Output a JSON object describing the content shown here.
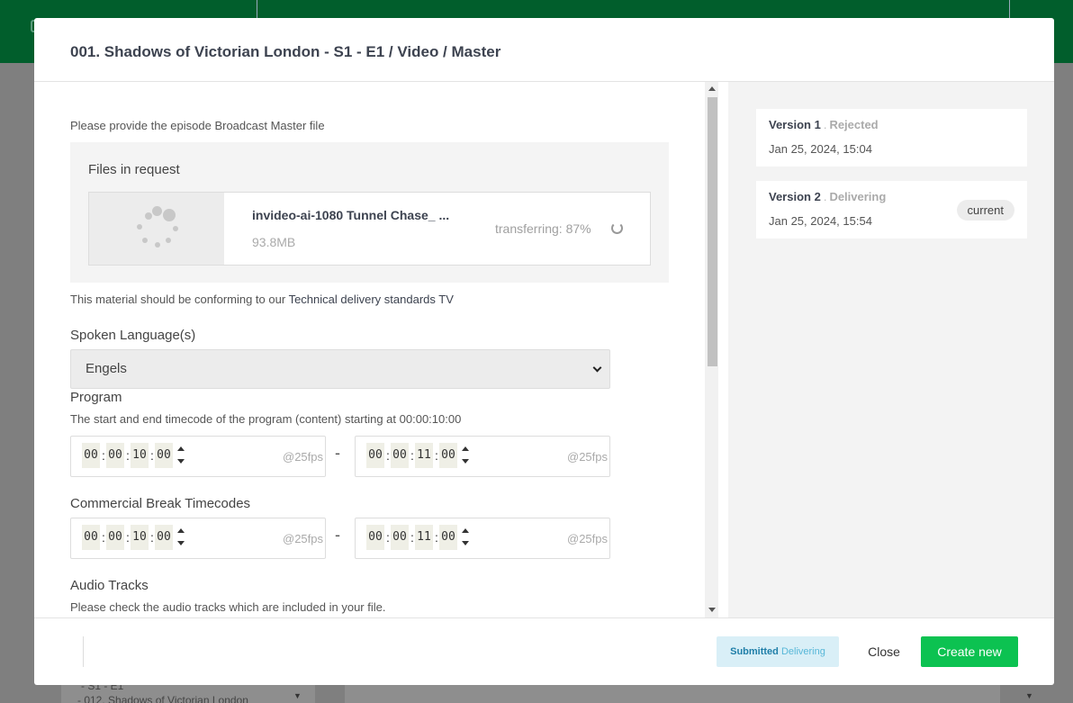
{
  "modal": {
    "title": "001. Shadows of Victorian London - S1 - E1 / Video / Master"
  },
  "request": {
    "instructions": "Please provide the episode Broadcast Master file",
    "files_title": "Files in request",
    "file": {
      "name": "invideo-ai-1080 Tunnel Chase_ ...",
      "size": "93.8MB",
      "status": "transferring: 87%",
      "progress_percent": 87
    },
    "conform_text": "This material should be conforming to our",
    "conform_link": "Technical delivery standards TV"
  },
  "spoken_language": {
    "label": "Spoken Language(s)",
    "value": "Engels"
  },
  "program": {
    "label": "Program",
    "description": "The start and end timecode of the program (content) starting at 00:00:10:00",
    "start": [
      "00",
      "00",
      "10",
      "00"
    ],
    "end": [
      "00",
      "00",
      "11",
      "00"
    ],
    "fps": "@25fps"
  },
  "commercial": {
    "label": "Commercial Break Timecodes",
    "start": [
      "00",
      "00",
      "10",
      "00"
    ],
    "end": [
      "00",
      "00",
      "11",
      "00"
    ],
    "fps": "@25fps"
  },
  "audio": {
    "label": "Audio Tracks",
    "description": "Please check the audio tracks which are included in your file."
  },
  "range_separator": "-",
  "versions": [
    {
      "title": "Version 1",
      "status": "Rejected",
      "date": "Jan 25, 2024, 15:04"
    },
    {
      "title": "Version 2",
      "status": "Delivering",
      "date": "Jan 25, 2024, 15:54",
      "tag": "current"
    }
  ],
  "footer": {
    "badge_submitted": "Submitted",
    "badge_delivering": "Delivering",
    "close_label": "Close",
    "create_label": "Create new"
  },
  "background": {
    "line1": "- S1 - E1",
    "line2": "- 012. Shadows of Victorian London"
  },
  "colors": {
    "header_green": "#015e2c",
    "primary_button": "#0cc251",
    "badge_bg": "#d9eff7",
    "badge_text": "#1f7ea8"
  }
}
